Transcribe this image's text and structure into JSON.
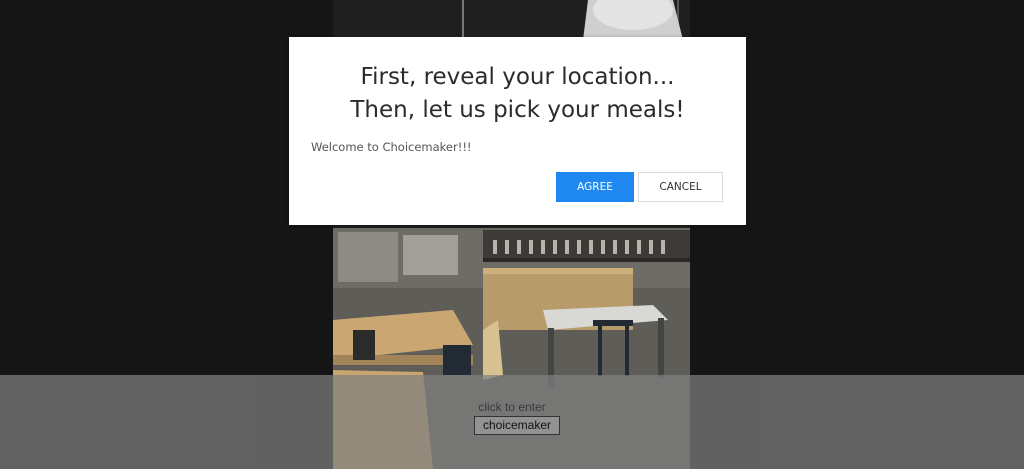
{
  "modal": {
    "title_line1": "First, reveal your location...",
    "title_line2": "Then, let us pick your meals!",
    "message": "Welcome to Choicemaker!!!",
    "agree_label": "AGREE",
    "cancel_label": "CANCEL",
    "agree_color": "#1e88f0"
  },
  "landing": {
    "hint": "click to enter",
    "enter_label": "choicemaker"
  },
  "background": {
    "image_icon": "restaurant-interior-photo"
  }
}
